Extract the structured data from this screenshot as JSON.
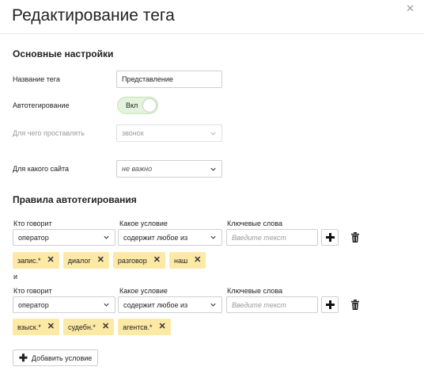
{
  "dialog": {
    "title": "Редактирование тега",
    "close_icon": "close-icon"
  },
  "basic": {
    "section_title": "Основные настройки",
    "tag_name_label": "Название тега",
    "tag_name_value": "Представление",
    "autotag_label": "Автотегирование",
    "autotag_toggle_label": "Вкл",
    "autotag_on": true,
    "apply_to_label": "Для чего проставлять",
    "apply_to_value": "звонок",
    "site_label": "Для какого сайта",
    "site_value": "не важно"
  },
  "rules": {
    "section_title": "Правила автотегирования",
    "col_speaker": "Кто говорит",
    "col_condition": "Какое условие",
    "col_keywords": "Ключевые слова",
    "keywords_placeholder": "Введите текст",
    "connector": "и",
    "items": [
      {
        "speaker": "оператор",
        "condition": "содержит любое из",
        "chips": [
          "запис.*",
          "диалог",
          "разговор",
          "наш"
        ]
      },
      {
        "speaker": "оператор",
        "condition": "содержит любое из",
        "chips": [
          "взыск.*",
          "судебн.*",
          "агентсв.*"
        ]
      }
    ],
    "add_condition_label": "Добавить условие"
  },
  "colors": {
    "chip_bg": "#fde9a6",
    "toggle_bg": "#e4f3dc"
  }
}
